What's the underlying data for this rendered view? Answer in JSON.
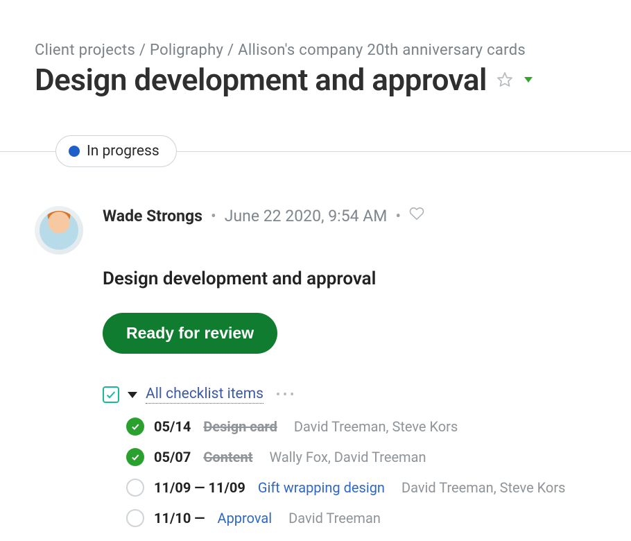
{
  "breadcrumb": {
    "items": [
      "Client projects",
      "Poligraphy",
      "Allison's company 20th anniversary cards"
    ]
  },
  "page": {
    "title": "Design development and approval"
  },
  "status": {
    "label": "In progress"
  },
  "post": {
    "author": "Wade Strongs",
    "timestamp": "June 22 2020, 9:54 AM",
    "title": "Design development and approval"
  },
  "review_button": {
    "label": "Ready for review"
  },
  "checklist": {
    "heading": "All checklist items",
    "items": [
      {
        "done": true,
        "date": "05/14",
        "title": "Design card",
        "assignees": "David Treeman, Steve Kors"
      },
      {
        "done": true,
        "date": "05/07",
        "title": "Content",
        "assignees": "Wally Fox, David Treeman"
      },
      {
        "done": false,
        "date": "11/09 — 11/09",
        "title": "Gift wrapping design",
        "assignees": "David Treeman, Steve Kors"
      },
      {
        "done": false,
        "date": "11/10 —",
        "title": "Approval",
        "assignees": "David Treeman"
      }
    ]
  }
}
